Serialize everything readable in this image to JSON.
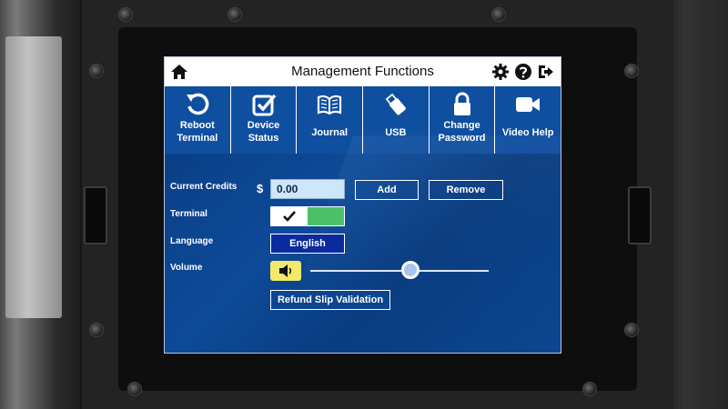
{
  "header": {
    "title": "Management Functions",
    "home_icon": "home-icon",
    "settings_icon": "gear-icon",
    "help_icon": "help-icon",
    "logout_icon": "logout-icon"
  },
  "toolbar": {
    "items": [
      {
        "label": "Reboot\nTerminal",
        "icon": "reboot-icon"
      },
      {
        "label": "Device\nStatus",
        "icon": "checkbox-icon"
      },
      {
        "label": "Journal",
        "icon": "book-icon"
      },
      {
        "label": "USB",
        "icon": "usb-icon"
      },
      {
        "label": "Change\nPassword",
        "icon": "lock-icon"
      },
      {
        "label": "Video Help",
        "icon": "video-camera-icon"
      }
    ]
  },
  "settings": {
    "credits_label": "Current Credits",
    "currency_symbol": "$",
    "credits_value": "0.00",
    "add_label": "Add",
    "remove_label": "Remove",
    "terminal_label": "Terminal",
    "terminal_enabled": true,
    "language_label": "Language",
    "language_value": "English",
    "volume_label": "Volume",
    "volume_level": 0.56,
    "refund_label": "Refund Slip Validation"
  },
  "colors": {
    "screen_blue": "#0d3a7e",
    "toolbar_blue": "#0f4fa0",
    "toggle_green": "#4cc16a",
    "language_blue": "#0a2a9e",
    "volume_yellow": "#f3e86c",
    "credits_field": "#cde6f8"
  }
}
